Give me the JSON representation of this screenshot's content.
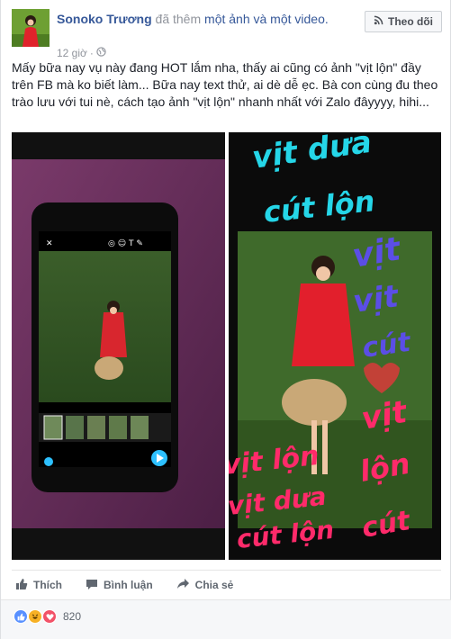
{
  "post": {
    "author": "Sonoko Trương",
    "action_text": "đã thêm",
    "action_link": "một ảnh và một video.",
    "time": "12 giờ",
    "privacy_separator": "·",
    "follow_label": "Theo dõi",
    "text": "Mấy bữa nay vụ này đang HOT lắm nha, thấy ai cũng có ảnh \"vịt lộn\" đầy trên FB mà ko biết làm... Bữa nay text thử, ai dè dễ ẹc. Bà con cùng đu theo trào lưu với tui nè, cách tạo ảnh \"vịt lộn\" nhanh nhất với Zalo đâyyyy, hihi..."
  },
  "actions": {
    "like": "Thích",
    "comment": "Bình luận",
    "share": "Chia sẻ"
  },
  "reactions": {
    "count": "820",
    "types": [
      "like",
      "haha",
      "love"
    ],
    "colors": {
      "like": "#5890ff",
      "haha": "#f7b125",
      "love": "#f25268"
    }
  },
  "colors": {
    "link": "#365899",
    "muted": "#90949c"
  },
  "overlay_text": {
    "word_1": "vịt dưa",
    "word_2": "cút lộn",
    "word_3": "vịt lộn"
  }
}
